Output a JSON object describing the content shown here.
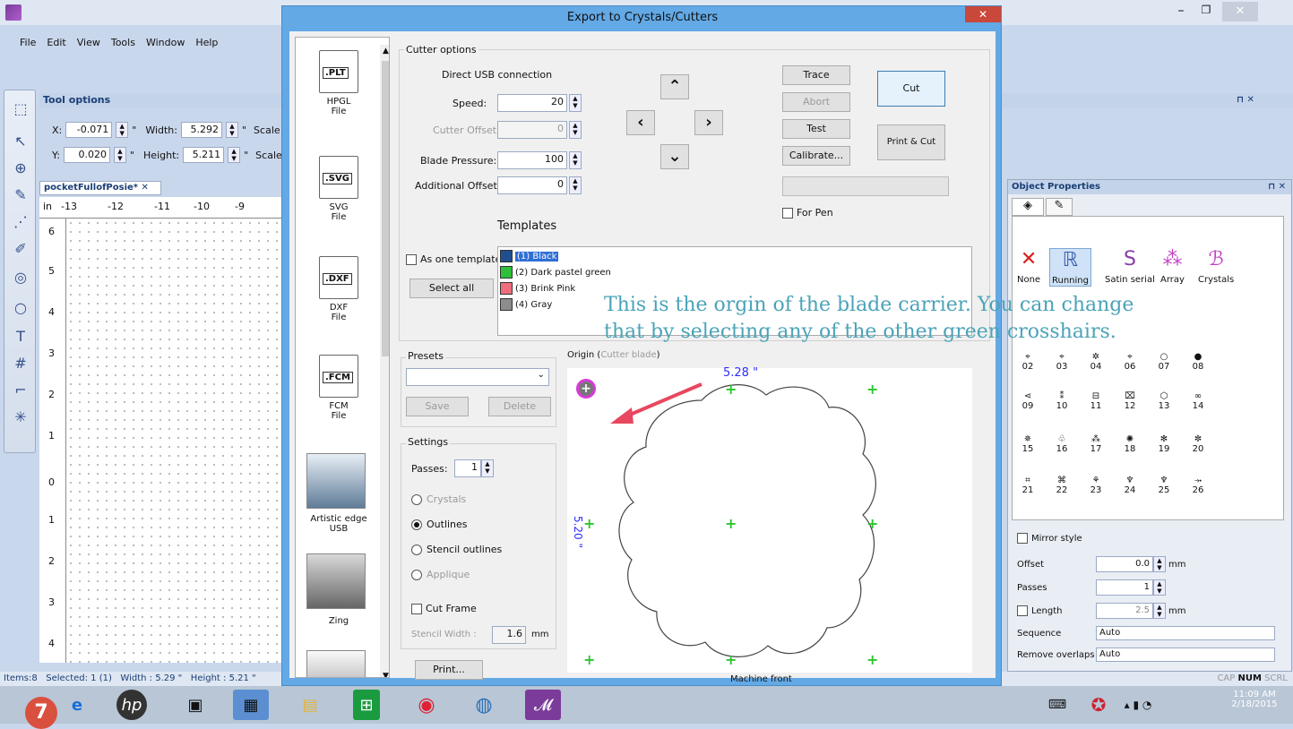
{
  "app": {
    "menu": [
      "File",
      "Edit",
      "View",
      "Tools",
      "Window",
      "Help"
    ],
    "tool_options_title": "Tool options",
    "x_label": "X:",
    "x_value": "-0.071",
    "y_label": "Y:",
    "y_value": "0.020",
    "width_label": "Width:",
    "width_value": "5.292",
    "height_label": "Height:",
    "height_value": "5.211",
    "unit": "\"",
    "scale_label": "Scale",
    "doc_tab": "pocketFullofPosie*",
    "ruler_top": [
      "in",
      "-13",
      "-12",
      "-11",
      "-10",
      "-9"
    ],
    "ruler_left": [
      "6",
      "5",
      "4",
      "3",
      "2",
      "1",
      "0",
      "1",
      "2",
      "3",
      "4"
    ],
    "status": {
      "items": "Items:8",
      "selected": "Selected: 1 (1)",
      "width": "Width : 5.29 \"",
      "height": "Height : 5.21 \""
    },
    "status_right": {
      "cap": "CAP",
      "num": "NUM",
      "scrl": "SCRL"
    }
  },
  "object_properties": {
    "title": "Object Properties",
    "styles": [
      "None",
      "Running",
      "Satin serial",
      "Array",
      "Crystals"
    ],
    "stitch_numbers": [
      "02",
      "03",
      "04",
      "06",
      "07",
      "08",
      "09",
      "10",
      "11",
      "12",
      "13",
      "14",
      "15",
      "16",
      "17",
      "18",
      "19",
      "20",
      "21",
      "22",
      "23",
      "24",
      "25",
      "26"
    ],
    "mirror_style": "Mirror style",
    "offset_label": "Offset",
    "offset_value": "0.0",
    "offset_unit": "mm",
    "passes_label": "Passes",
    "passes_value": "1",
    "length_label": "Length",
    "length_value": "2.5",
    "length_unit": "mm",
    "sequence_label": "Sequence",
    "sequence_value": "Auto",
    "remove_overlaps_label": "Remove overlaps",
    "remove_overlaps_value": "Auto"
  },
  "dialog": {
    "title": "Export to Crystals/Cutters",
    "close": "✕",
    "formats": [
      {
        "badge": ".PLT",
        "label1": "HPGL",
        "label2": "File"
      },
      {
        "badge": ".SVG",
        "label1": "SVG",
        "label2": "File"
      },
      {
        "badge": ".DXF",
        "label1": "DXF",
        "label2": "File"
      },
      {
        "badge": ".FCM",
        "label1": "FCM",
        "label2": "File"
      }
    ],
    "devices": [
      "Artistic edge USB",
      "Zing"
    ],
    "cutter_options": "Cutter options",
    "connection": "Direct USB connection",
    "speed_label": "Speed:",
    "speed_value": "20",
    "cutter_offset_label": "Cutter Offset:",
    "cutter_offset_value": "0",
    "blade_pressure_label": "Blade Pressure:",
    "blade_pressure_value": "100",
    "additional_offset_label": "Additional Offset:",
    "additional_offset_value": "0",
    "trace": "Trace",
    "abort": "Abort",
    "test": "Test",
    "calibrate": "Calibrate...",
    "cut": "Cut",
    "print_cut": "Print & Cut",
    "for_pen": "For Pen",
    "templates_title": "Templates",
    "as_one_template": "As one template",
    "select_all": "Select all",
    "templates": [
      {
        "name": "(1) Black",
        "color": "#1f4f8f"
      },
      {
        "name": "(2) Dark pastel green",
        "color": "#2fbf3a"
      },
      {
        "name": "(3) Brink Pink",
        "color": "#f06d7e"
      },
      {
        "name": "(4) Gray",
        "color": "#8c8c8c"
      }
    ],
    "presets_title": "Presets",
    "save": "Save",
    "delete": "Delete",
    "settings_title": "Settings",
    "passes_label": "Passes:",
    "passes_value": "1",
    "radio_crystals": "Crystals",
    "radio_outlines": "Outlines",
    "radio_stencil": "Stencil outlines",
    "radio_applique": "Applique",
    "cut_frame": "Cut Frame",
    "stencil_width_label": "Stencil Width :",
    "stencil_width_value": "1.6",
    "stencil_width_unit": "mm",
    "print": "Print...",
    "origin_label": "Origin (",
    "origin_sub": "Cutter blade",
    "origin_close": ")",
    "dim_h": "5.28 \"",
    "dim_v": "5.20 \"",
    "machine_front": "Machine front"
  },
  "annotation": {
    "line1": "This is the orgin of the blade carrier. You can change",
    "line2": "that by selecting any of the other green crosshairs."
  },
  "taskbar": {
    "badge": "7",
    "time": "11:09 AM",
    "date": "2/18/2015"
  }
}
